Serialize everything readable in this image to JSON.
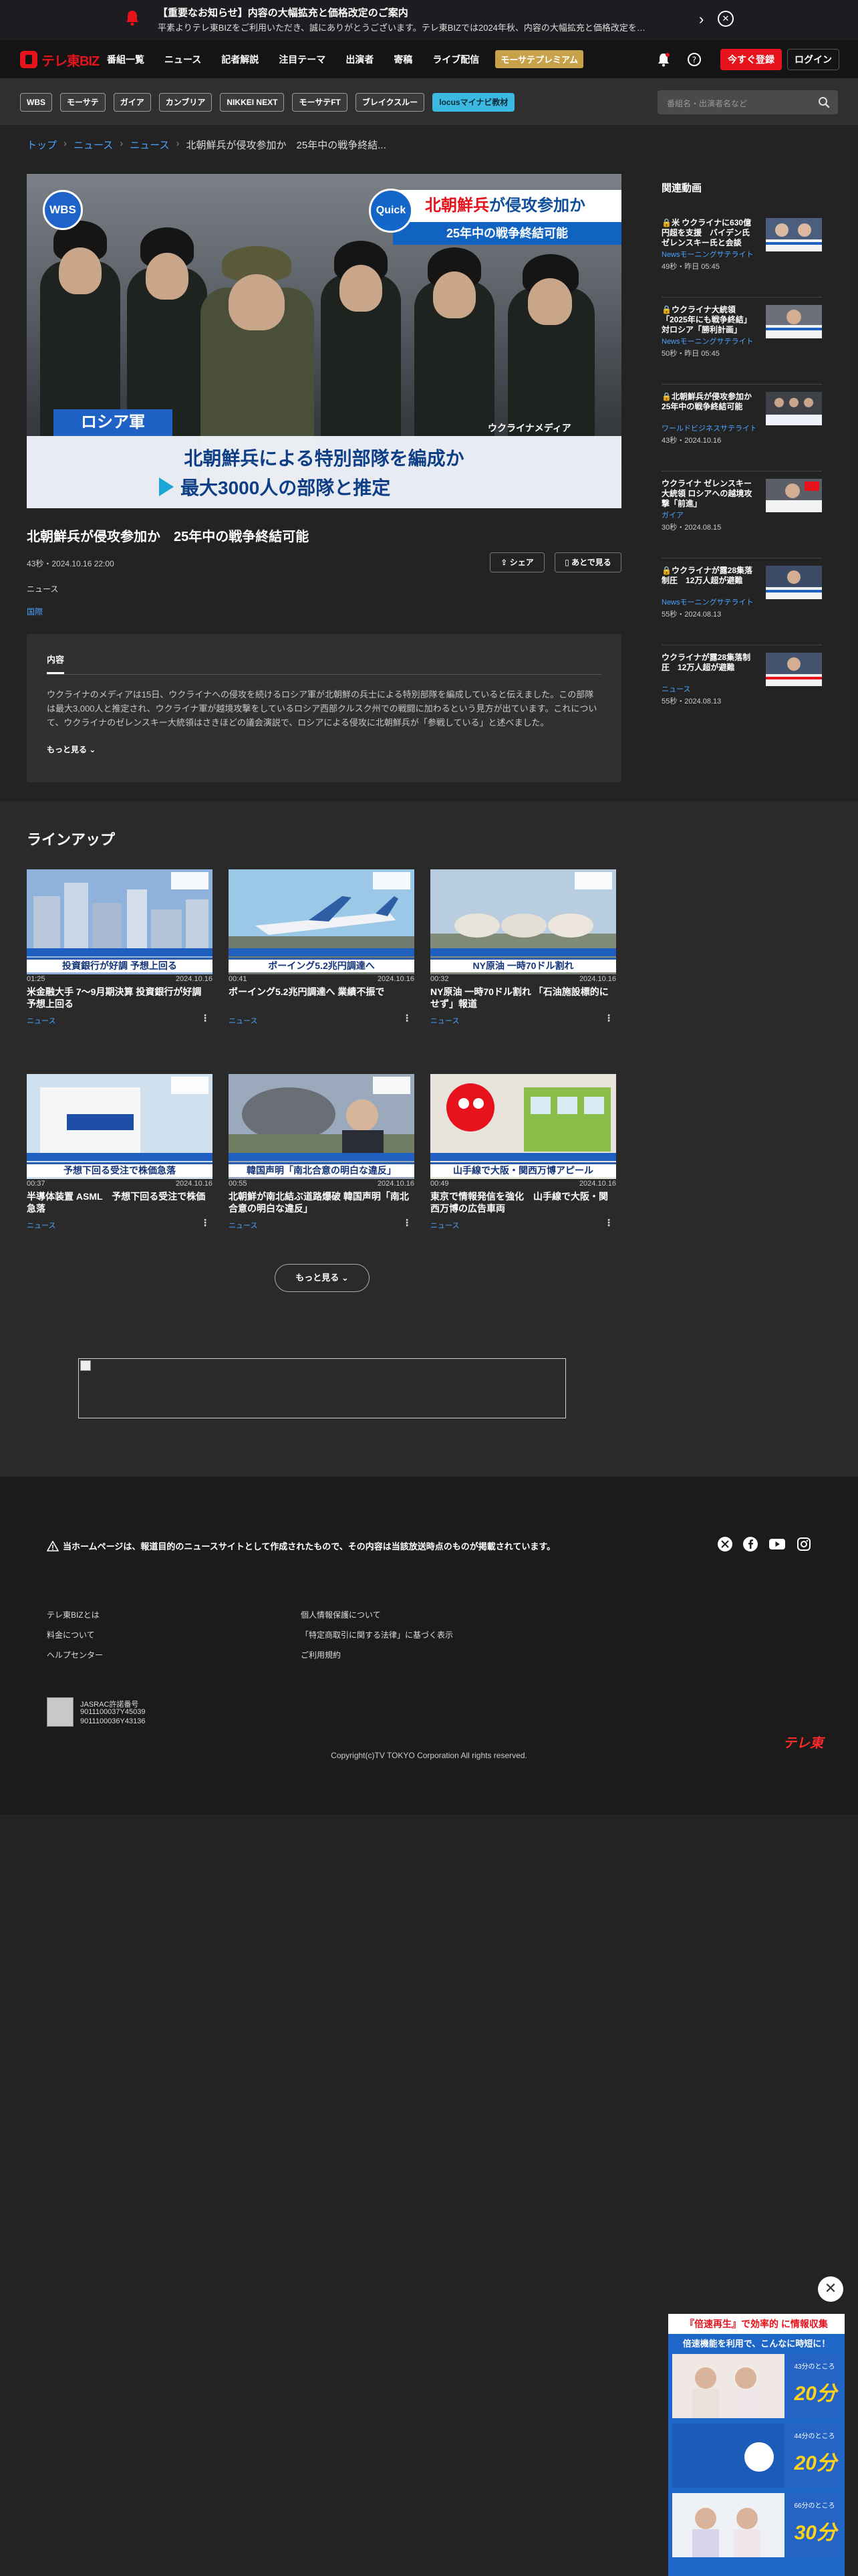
{
  "notice": {
    "title": "【重要なお知らせ】内容の大幅拡充と価格改定のご案内",
    "text": "平素よりテレ東BIZをご利用いただき、誠にありがとうございます。テレ東BIZでは2024年秋、内容の大幅拡充と価格改定を…"
  },
  "header": {
    "logo": "テレ東BIZ",
    "nav": [
      "番組一覧",
      "ニュース",
      "記者解説",
      "注目テーマ",
      "出演者",
      "寄稿",
      "ライブ配信"
    ],
    "premium": "モーサテプレミアム",
    "register": "今すぐ登録",
    "login": "ログイン"
  },
  "subnav": {
    "chips": [
      "WBS",
      "モーサテ",
      "ガイア",
      "カンブリア",
      "NIKKEI NEXT",
      "モーサテFT",
      "ブレイクスルー"
    ],
    "locus": "locusマイナビ教材",
    "search_placeholder": "番組名・出演者名など"
  },
  "breadcrumb": {
    "top": "トップ",
    "news1": "ニュース",
    "news2": "ニュース",
    "current": "北朝鮮兵が侵攻参加か　25年中の戦争終結..."
  },
  "player": {
    "wbs": "WBS",
    "quick": "Quick",
    "tag1_red": "北朝鮮兵",
    "tag1_rest": "が侵攻参加か",
    "tag2": "25年中の戦争終結可能",
    "russia": "ロシア軍",
    "media": "ウクライナメディア",
    "caption1": "北朝鮮兵による特別部隊を編成か",
    "caption2": "最大3000人の部隊と推定"
  },
  "video": {
    "title": "北朝鮮兵が侵攻参加か　25年中の戦争終結可能",
    "meta": "43秒・2024.10.16 22:00",
    "share": "シェア",
    "watch_later": "あとで見る",
    "category": "ニュース",
    "tag": "国際",
    "tab": "内容",
    "description": "ウクライナのメディアは15日、ウクライナへの侵攻を続けるロシア軍が北朝鮮の兵士による特別部隊を編成していると伝えました。この部隊は最大3,000人と推定され、ウクライナ軍が越境攻撃をしているロシア西部クルスク州での戦闘に加わるという見方が出ています。これについて、ウクライナのゼレンスキー大統領はさきほどの議会演説で、ロシアによる侵攻に北朝鮮兵が「参戦している」と述べました。",
    "more": "もっと見る"
  },
  "related": {
    "title": "関連動画",
    "items": [
      {
        "title": "米 ウクライナに630億円超を支援　バイデン氏 ゼレンスキー氏と会談",
        "series": "Newsモーニングサテライト",
        "meta": "49秒・昨日 05:45",
        "locked": true
      },
      {
        "title": "ウクライナ大統領「2025年にも戦争終結」 対ロシア「勝利計画」",
        "series": "Newsモーニングサテライト",
        "meta": "50秒・昨日 05:45",
        "locked": true
      },
      {
        "title": "北朝鮮兵が侵攻参加か　25年中の戦争終結可能",
        "series": "ワールドビジネスサテライト",
        "meta": "43秒・2024.10.16",
        "locked": true
      },
      {
        "title": "ウクライナ ゼレンスキー大統領 ロシアへの越境攻撃「前進」",
        "series": "ガイア",
        "meta": "30秒・2024.08.15",
        "locked": false
      },
      {
        "title": "ウクライナが露28集落制圧　12万人超が避難",
        "series": "Newsモーニングサテライト",
        "meta": "55秒・2024.08.13",
        "locked": true
      },
      {
        "title": "ウクライナが露28集落制圧　12万人超が避難",
        "series": "ニュース",
        "meta": "55秒・2024.08.13",
        "locked": false
      }
    ]
  },
  "lineup": {
    "title": "ラインアップ",
    "more": "もっと見る",
    "cards": [
      {
        "duration": "01:25",
        "date": "2024.10.16",
        "title": "米金融大手 7～9月期決算 投資銀行が好調 予想上回る",
        "category": "ニュース",
        "band": "投資銀行が好調 予想上回る"
      },
      {
        "duration": "00:41",
        "date": "2024.10.16",
        "title": "ボーイング5.2兆円調達へ 業績不振で",
        "category": "ニュース",
        "band": "ボーイング5.2兆円調達へ"
      },
      {
        "duration": "00:32",
        "date": "2024.10.16",
        "title": "NY原油 一時70ドル割れ 「石油施設標的にせず」報道",
        "category": "ニュース",
        "band": "NY原油 一時70ドル割れ"
      },
      {
        "duration": "00:37",
        "date": "2024.10.16",
        "title": "半導体装置 ASML　予想下回る受注で株価急落",
        "category": "ニュース",
        "band": "予想下回る受注で株価急落"
      },
      {
        "duration": "00:55",
        "date": "2024.10.16",
        "title": "北朝鮮が南北結ぶ道路爆破 韓国声明「南北合意の明白な違反」",
        "category": "ニュース",
        "band": "韓国声明「南北合意の明白な違反」"
      },
      {
        "duration": "00:49",
        "date": "2024.10.16",
        "title": "東京で情報発信を強化　山手線で大阪・関西万博の広告車両",
        "category": "ニュース",
        "band": "山手線で大阪・関西万博アピール"
      }
    ]
  },
  "footer": {
    "warning": "当ホームページは、報道目的のニュースサイトとして作成されたもので、その内容は当該放送時点のものが掲載されています。",
    "links_left": [
      "テレ東BIZとは",
      "料金について",
      "ヘルプセンター"
    ],
    "links_right": [
      "個人情報保護について",
      "「特定商取引に関する法律」に基づく表示",
      "ご利用規約"
    ],
    "jasrac_label": "JASRAC許諾番号",
    "jasrac_no1": "9011100037Y45039",
    "jasrac_no2": "9011100036Y43136",
    "copyright": "Copyright(c)TV TOKYO Corporation All rights reserved.",
    "logo": "テレ東"
  },
  "float_ad": {
    "header": "『倍速再生』で効率的 に情報収集",
    "subheader": "倍速機能を利用で、こんなに時短に！",
    "items": [
      {
        "time": "43分のところ",
        "value": "20分"
      },
      {
        "time": "44分のところ",
        "value": "20分"
      },
      {
        "time": "66分のところ",
        "value": "30分"
      }
    ]
  },
  "colors": {
    "accent_red": "#e6121c",
    "link_blue": "#4aa3ff",
    "bg": "#232323"
  }
}
